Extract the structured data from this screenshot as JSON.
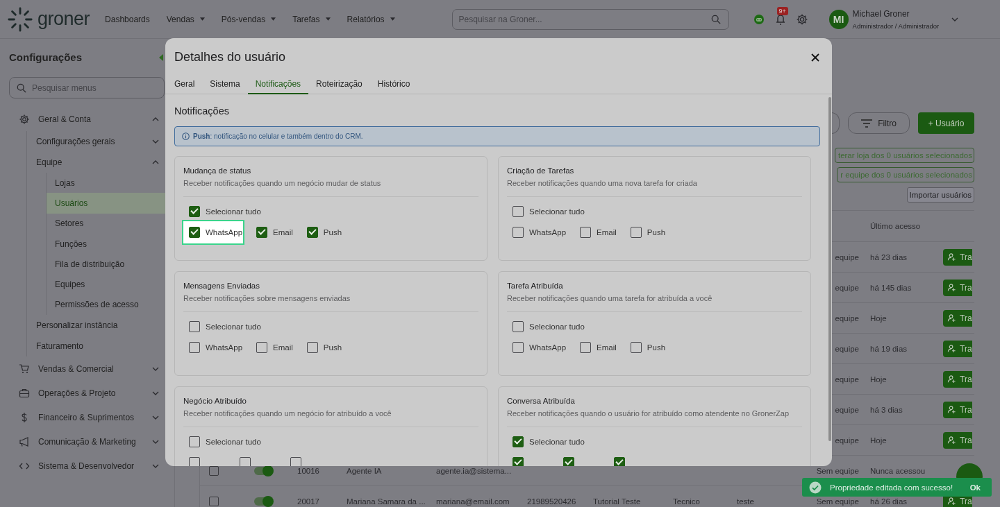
{
  "topbar": {
    "logo": "groner",
    "nav": [
      {
        "label": "Dashboards",
        "dropdown": false
      },
      {
        "label": "Vendas",
        "dropdown": true
      },
      {
        "label": "Pós-vendas",
        "dropdown": true
      },
      {
        "label": "Tarefas",
        "dropdown": true
      },
      {
        "label": "Relatórios",
        "dropdown": true
      }
    ],
    "search": {
      "placeholder": "Pesquisar na Groner..."
    },
    "notifications_badge": "9+",
    "user": {
      "initials": "MI",
      "name": "Michael Groner",
      "role": "Administrador / Administrador"
    }
  },
  "sidebar": {
    "title": "Configurações",
    "search": {
      "placeholder": "Pesquisar menus"
    },
    "items": [
      {
        "label": "Geral & Conta",
        "expanded": true,
        "selected": false,
        "children": [
          {
            "label": "Configurações gerais",
            "expanded": false,
            "selected": false
          },
          {
            "label": "Equipe",
            "expanded": true,
            "selected": false,
            "children": [
              {
                "label": "Lojas",
                "selected": false
              },
              {
                "label": "Usuários",
                "selected": true
              },
              {
                "label": "Setores",
                "selected": false
              },
              {
                "label": "Funções",
                "selected": false
              },
              {
                "label": "Fila de distribuição",
                "selected": false
              },
              {
                "label": "Equipes",
                "selected": false
              },
              {
                "label": "Permissões de acesso",
                "selected": false
              }
            ]
          },
          {
            "label": "Personalizar instância",
            "selected": false
          },
          {
            "label": "Faturamento",
            "selected": false
          }
        ]
      },
      {
        "label": "Vendas & Comercial",
        "expanded": false,
        "selected": false
      },
      {
        "label": "Operações & Projeto",
        "expanded": false,
        "selected": false
      },
      {
        "label": "Financeiro & Suprimentos",
        "expanded": false,
        "selected": false
      },
      {
        "label": "Comunicação & Marketing",
        "expanded": false,
        "selected": false
      },
      {
        "label": "Sistema & Desenvolvedor",
        "expanded": false,
        "selected": false
      }
    ]
  },
  "toolbar": {
    "filter_button": "Filtro",
    "add_button": "+ Usuário"
  },
  "bulk_actions": [
    "terar loja dos 0 usuários selecionados",
    "r equipe dos 0 usuários selecionados"
  ],
  "import_button": "Importar usuários",
  "table": {
    "column_11": "Último acesso",
    "rows": [
      {
        "cells": {
          "column_10": "equipe",
          "column_11": "há 23 dias"
        },
        "action": "Tra"
      },
      {
        "cells": {
          "column_10": "equipe",
          "column_11": "há 145 dias"
        },
        "action": "Tra"
      },
      {
        "cells": {
          "column_10": "equipe",
          "column_11": "Hoje"
        },
        "action": "Tra"
      },
      {
        "cells": {
          "column_10": "equipe",
          "column_11": "há 19 dias"
        },
        "action": "Tra"
      },
      {
        "cells": {
          "column_10": "equipe",
          "column_11": "Hoje"
        },
        "action": "Tra"
      },
      {
        "cells": {
          "column_10": "equipe",
          "column_11": "há 3 dias"
        },
        "action": "Tra"
      },
      {
        "cells": {
          "column_10": "equipe",
          "column_11": "Hoje"
        },
        "action": "Tra"
      },
      {
        "checked": false,
        "active": true,
        "cells": {
          "column_3": "10016",
          "column_4": "Agente IA",
          "column_5": "agente.ia@sistema...",
          "column_10": "Sem equipe",
          "column_11": "Nunca acessou"
        }
      },
      {
        "checked": false,
        "active": true,
        "cells": {
          "column_3": "20017",
          "column_4": "Mariana Samara da ...",
          "column_5": "mariana@email.com",
          "column_6": "21989520426",
          "column_7": "Tutorial Teste",
          "column_8": "Tecnico",
          "column_9": "teste",
          "column_10": "Sem equipe",
          "column_11": "há 26 dias"
        },
        "action": "Tra"
      }
    ]
  },
  "modal": {
    "title": "Detalhes do usuário",
    "tabs": [
      {
        "label": "Geral",
        "selected": false
      },
      {
        "label": "Sistema",
        "selected": false
      },
      {
        "label": "Notificações",
        "selected": true
      },
      {
        "label": "Roteirização",
        "selected": false
      },
      {
        "label": "Histórico",
        "selected": false
      }
    ],
    "section_title": "Notificações",
    "info": "**Push**: notificação no celular e também dentro do CRM.",
    "cards": [
      {
        "title": "Mudança de status",
        "description": "Receber notificações quando um negócio mudar de status",
        "select_all": {
          "label": "Selecionar tudo",
          "checked": true
        },
        "options": [
          {
            "kind": "highlighted",
            "label": "WhatsApp",
            "checked": true
          },
          {
            "kind": "plain",
            "label": "Email",
            "checked": true
          },
          {
            "kind": "plain",
            "label": "Push",
            "checked": true
          }
        ]
      },
      {
        "title": "Criação de Tarefas",
        "description": "Receber notificações quando uma nova tarefa for criada",
        "select_all": {
          "label": "Selecionar tudo",
          "checked": false
        },
        "options": [
          {
            "label": "WhatsApp",
            "checked": false
          },
          {
            "label": "Email",
            "checked": false
          },
          {
            "label": "Push",
            "checked": false
          }
        ]
      },
      {
        "title": "Mensagens Enviadas",
        "description": "Receber notificações sobre mensagens enviadas",
        "select_all": {
          "label": "Selecionar tudo",
          "checked": false
        },
        "options": [
          {
            "label": "WhatsApp",
            "checked": false
          },
          {
            "label": "Email",
            "checked": false
          },
          {
            "label": "Push",
            "checked": false
          }
        ]
      },
      {
        "title": "Tarefa Atribuída",
        "description": "Receber notificações quando uma tarefa for atribuída a você",
        "select_all": {
          "label": "Selecionar tudo",
          "checked": false
        },
        "options": [
          {
            "label": "WhatsApp",
            "checked": false
          },
          {
            "label": "Email",
            "checked": false
          },
          {
            "label": "Push",
            "checked": false
          }
        ]
      },
      {
        "title": "Negócio Atribuído",
        "description": "Receber notificações quando um negócio for atribuído a você",
        "select_all": {
          "label": "Selecionar tudo",
          "checked": false
        },
        "options": [
          {
            "checked": false
          },
          {
            "checked": false
          },
          {
            "checked": false
          }
        ]
      },
      {
        "title": "Conversa Atribuída",
        "description": "Receber notificações quando o usuário for atribuído como atendente no GronerZap",
        "select_all": {
          "label": "Selecionar tudo",
          "checked": true
        },
        "options": [
          {
            "checked": true
          },
          {
            "checked": true
          },
          {
            "checked": true
          }
        ]
      }
    ]
  },
  "toast": {
    "message": "Propriedade editada com sucesso!",
    "action": "Ok"
  }
}
